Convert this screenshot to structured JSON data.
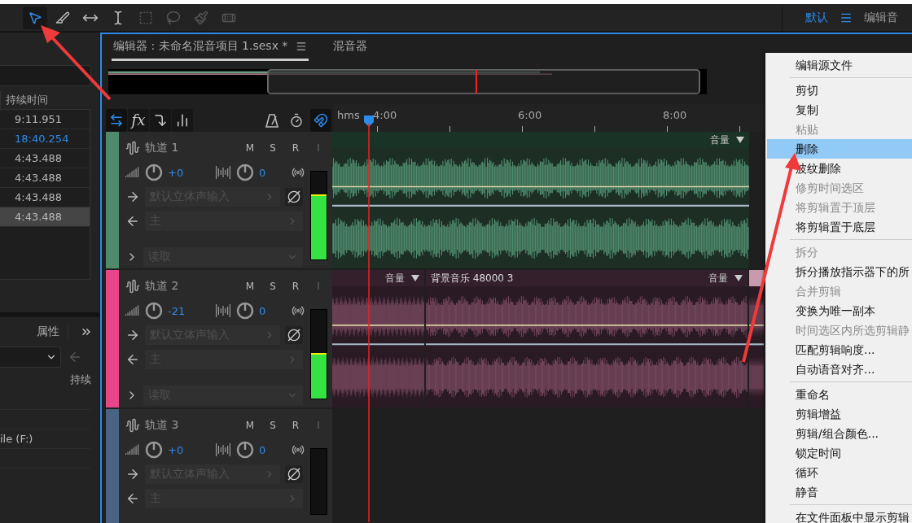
{
  "top_bar": {
    "workspace": "默认",
    "workspace_next": "编辑音"
  },
  "files_panel": {
    "column": "持续时间",
    "rows": [
      {
        "duration": "9:11.951",
        "active": false,
        "selected": false
      },
      {
        "duration": "18:40.254",
        "active": true,
        "selected": false
      },
      {
        "duration": "4:43.488",
        "active": false,
        "selected": false
      },
      {
        "duration": "4:43.488",
        "active": false,
        "selected": false
      },
      {
        "duration": "4:43.488",
        "active": false,
        "selected": false
      },
      {
        "duration": "4:43.488",
        "active": false,
        "selected": true
      }
    ]
  },
  "lower_panel": {
    "tab": "属性",
    "column": "持续",
    "rows": [
      "",
      "",
      "ile (F:)",
      ""
    ]
  },
  "editor": {
    "tabs": [
      {
        "label": "编辑器 : 未命名混音项目 1.sesx *",
        "selected": true
      },
      {
        "label": "混音器",
        "selected": false
      }
    ],
    "fx_label": "fx",
    "snap_on": true,
    "ruler": {
      "unit": "hms",
      "labels": [
        "4:00",
        "6:00",
        "8:00"
      ]
    },
    "tracks": [
      {
        "name": "轨道 1",
        "color": "#4f8a6c",
        "buttons": [
          "M",
          "S",
          "R",
          "I"
        ],
        "volume": "+0",
        "pan": "0",
        "input": "默认立体声输入",
        "output": "主",
        "automation": "读取",
        "meter": {
          "level": 0.72
        },
        "clips": [
          {
            "envelope": "音量",
            "selected": false
          }
        ]
      },
      {
        "name": "轨道 2",
        "color": "#e8468a",
        "buttons": [
          "M",
          "S",
          "R",
          "I"
        ],
        "volume": "-21",
        "pan": "0",
        "input": "默认立体声输入",
        "output": "主",
        "automation": "读取",
        "meter": {
          "level": 0.5
        },
        "clips": [
          {
            "envelope": "音量",
            "selected": false
          },
          {
            "title": "背景音乐 48000 3",
            "envelope": "音量",
            "selected": false
          },
          {
            "selected": true
          }
        ]
      },
      {
        "name": "轨道 3",
        "color": "#4a6384",
        "buttons": [
          "M",
          "S",
          "R",
          "I"
        ],
        "volume": "+0",
        "pan": "0",
        "input": "默认立体声输入",
        "output": "主"
      }
    ]
  },
  "context_menu": {
    "groups": [
      [
        {
          "label": "编辑源文件",
          "disabled": false,
          "selected": false
        }
      ],
      [
        {
          "label": "剪切",
          "disabled": false,
          "selected": false
        },
        {
          "label": "复制",
          "disabled": false,
          "selected": false
        },
        {
          "label": "粘贴",
          "disabled": true,
          "selected": false
        },
        {
          "label": "删除",
          "disabled": false,
          "selected": true
        },
        {
          "label": "波纹删除",
          "disabled": false,
          "selected": false
        },
        {
          "label": "修剪时间选区",
          "disabled": true,
          "selected": false
        },
        {
          "label": "将剪辑置于顶层",
          "disabled": true,
          "selected": false
        },
        {
          "label": "将剪辑置于底层",
          "disabled": false,
          "selected": false
        }
      ],
      [
        {
          "label": "拆分",
          "disabled": true,
          "selected": false
        },
        {
          "label": "拆分播放指示器下的所",
          "disabled": false,
          "selected": false
        },
        {
          "label": "合并剪辑",
          "disabled": true,
          "selected": false
        },
        {
          "label": "变换为唯一副本",
          "disabled": false,
          "selected": false
        },
        {
          "label": "时间选区内所选剪辑静",
          "disabled": true,
          "selected": false
        },
        {
          "label": "匹配剪辑响度...",
          "disabled": false,
          "selected": false
        },
        {
          "label": "自动语音对齐...",
          "disabled": false,
          "selected": false
        }
      ],
      [
        {
          "label": "重命名",
          "disabled": false,
          "selected": false
        },
        {
          "label": "剪辑增益",
          "disabled": false,
          "selected": false
        },
        {
          "label": "剪辑/组合颜色...",
          "disabled": false,
          "selected": false
        },
        {
          "label": "锁定时间",
          "disabled": false,
          "selected": false
        },
        {
          "label": "循环",
          "disabled": false,
          "selected": false
        },
        {
          "label": "静音",
          "disabled": false,
          "selected": false
        }
      ],
      [
        {
          "label": "在文件面板中显示剪辑",
          "disabled": false,
          "selected": false
        }
      ]
    ]
  }
}
